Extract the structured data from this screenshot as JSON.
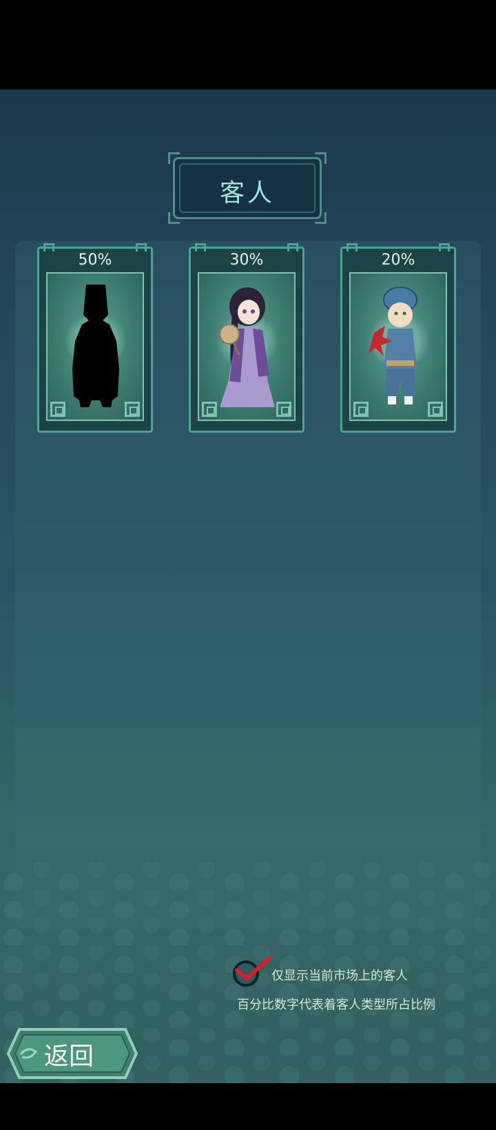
{
  "title": "客人",
  "cards": [
    {
      "percent": "50%",
      "character": "silhouette-customer"
    },
    {
      "percent": "30%",
      "character": "lady-customer"
    },
    {
      "percent": "20%",
      "character": "boy-customer"
    }
  ],
  "footer": {
    "checkbox_label": "仅显示当前市场上的客人",
    "note": "百分比数字代表着客人类型所占比例"
  },
  "back_button": {
    "label": "返回"
  },
  "colors": {
    "accent": "#4fa594",
    "title_text": "#9fe3e0",
    "check": "#d81e2a"
  }
}
